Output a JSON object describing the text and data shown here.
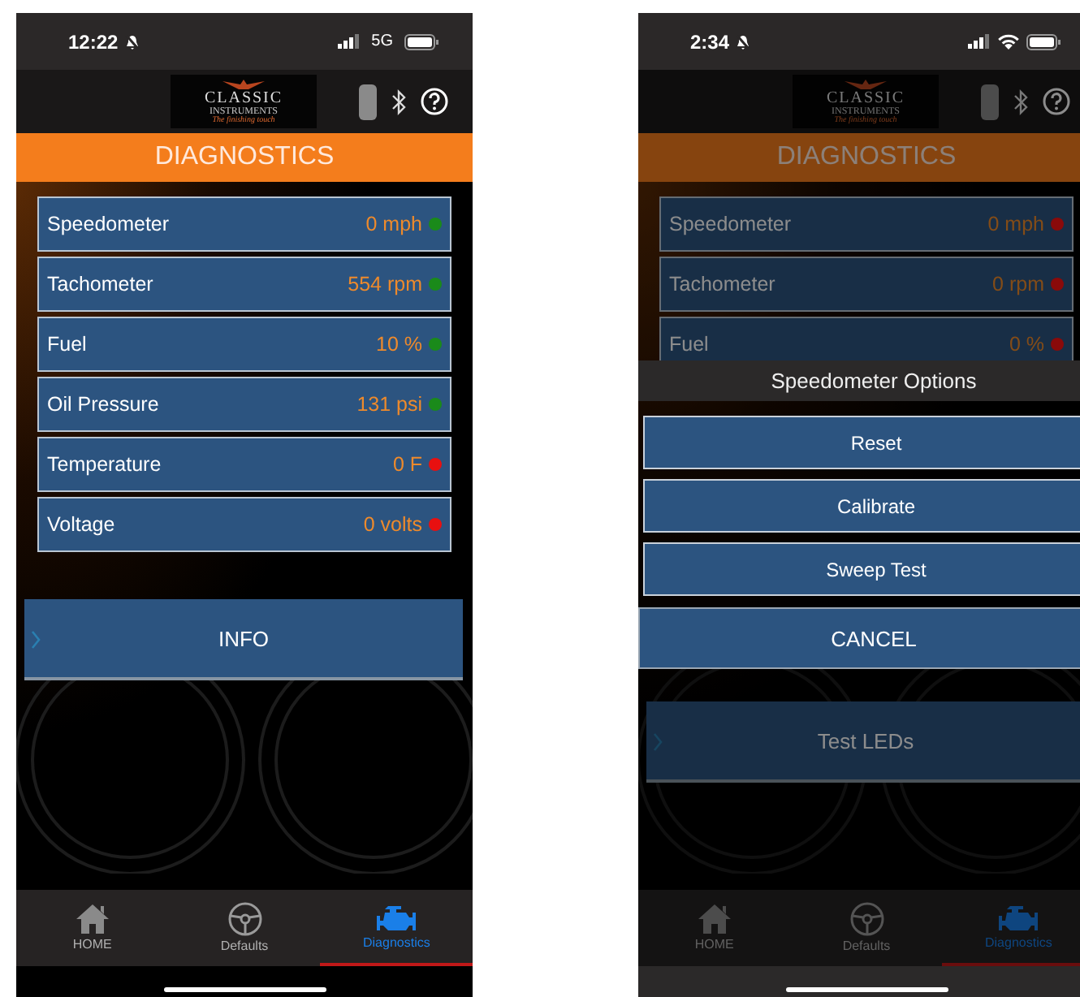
{
  "screens": [
    {
      "status_bar": {
        "time": "12:22",
        "connection": {
          "kind": "cellular",
          "label": "5G"
        }
      },
      "logo": {
        "name": "CLASSIC",
        "subname": "INSTRUMENTS",
        "tagline": "The finishing touch"
      },
      "title": "DIAGNOSTICS",
      "dimmed": false,
      "gauges": [
        {
          "name": "Speedometer",
          "reading": "0 mph",
          "color": "#1a8a1a"
        },
        {
          "name": "Tachometer",
          "reading": "554 rpm",
          "color": "#1a8a1a"
        },
        {
          "name": "Fuel",
          "reading": "10 %",
          "color": "#1a8a1a"
        },
        {
          "name": "Oil Pressure",
          "reading": "131 psi",
          "color": "#1a8a1a"
        },
        {
          "name": "Temperature",
          "reading": "0 F",
          "color": "#e81010"
        },
        {
          "name": "Voltage",
          "reading": "0 volts",
          "color": "#e81010"
        }
      ],
      "buttons": [
        {
          "label": "INFO"
        }
      ],
      "tabs": [
        {
          "label": "HOME",
          "selected": false
        },
        {
          "label": "Defaults",
          "selected": false
        },
        {
          "label": "Diagnostics",
          "selected": true
        }
      ]
    },
    {
      "status_bar": {
        "time": "2:34",
        "connection": {
          "kind": "wifi"
        }
      },
      "logo": {
        "name": "CLASSIC",
        "subname": "INSTRUMENTS",
        "tagline": "The finishing touch"
      },
      "title": "DIAGNOSTICS",
      "dimmed": true,
      "gauges": [
        {
          "name": "Speedometer",
          "reading": "0 mph",
          "color": "#8a0a0a"
        },
        {
          "name": "Tachometer",
          "reading": "0 rpm",
          "color": "#8a0a0a"
        },
        {
          "name": "Fuel",
          "reading": "0 %",
          "color": "#8a0a0a"
        }
      ],
      "buttons": [
        {
          "label": "Test LEDs"
        }
      ],
      "tabs": [
        {
          "label": "HOME",
          "selected": false
        },
        {
          "label": "Defaults",
          "selected": false
        },
        {
          "label": "Diagnostics",
          "selected": true
        }
      ],
      "action_sheet": {
        "title": "Speedometer Options",
        "options": [
          "Reset",
          "Calibrate",
          "Sweep Test"
        ],
        "cancel": "CANCEL"
      }
    }
  ]
}
